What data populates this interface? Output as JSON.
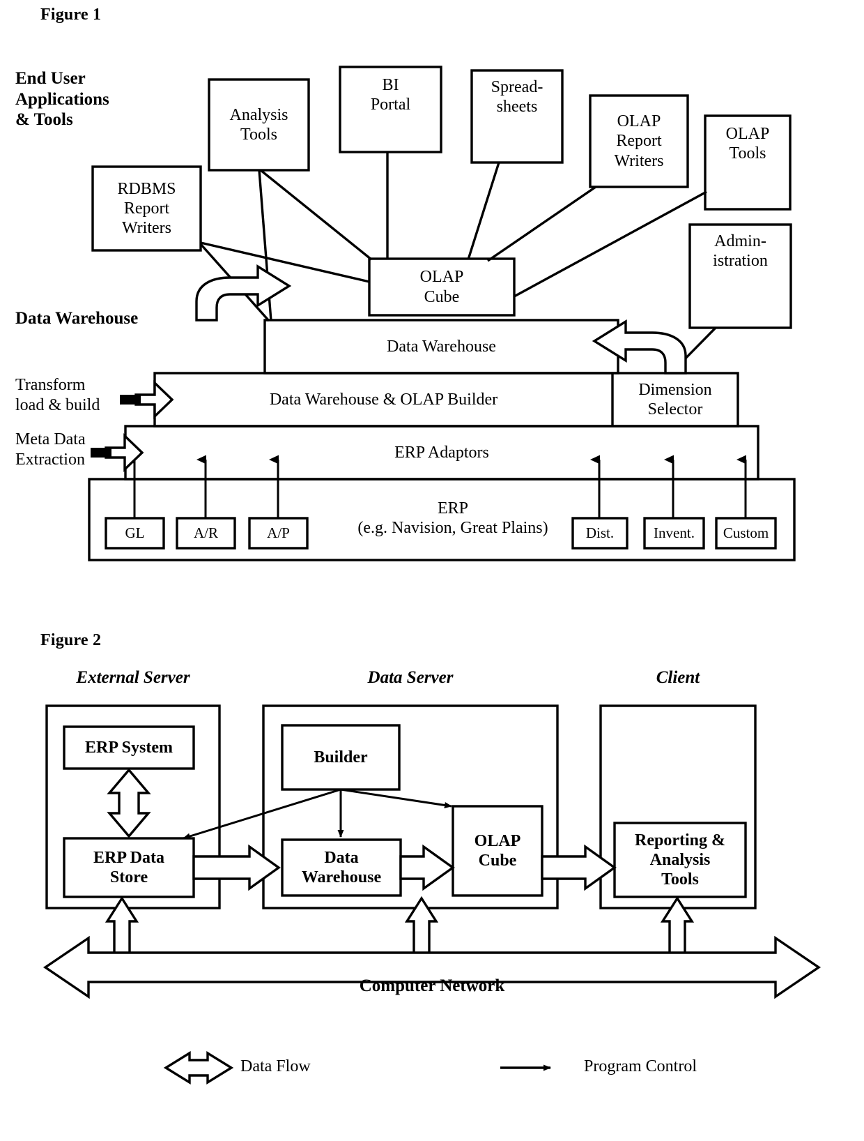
{
  "figure1": {
    "label": "Figure 1",
    "band_labels": {
      "end_user": "End User\nApplications\n& Tools",
      "end_user_l1": "End User",
      "end_user_l2": "Applications",
      "end_user_l3": "& Tools",
      "data_warehouse": "Data Warehouse"
    },
    "side_labels": {
      "transform_l1": "Transform",
      "transform_l2": "load & build",
      "meta_l1": "Meta Data",
      "meta_l2": "Extraction"
    },
    "tool_boxes": [
      {
        "name": "rdbms-report-writers",
        "lines": [
          "RDBMS",
          "Report",
          "Writers"
        ]
      },
      {
        "name": "analysis-tools",
        "lines": [
          "Analysis",
          "Tools"
        ]
      },
      {
        "name": "bi-portal",
        "lines": [
          "BI",
          "Portal"
        ]
      },
      {
        "name": "spreadsheets",
        "lines": [
          "Spread-",
          "sheets"
        ]
      },
      {
        "name": "olap-report-writers",
        "lines": [
          "OLAP",
          "Report",
          "Writers"
        ]
      },
      {
        "name": "olap-tools",
        "lines": [
          "OLAP",
          "Tools"
        ]
      },
      {
        "name": "administration",
        "lines": [
          "Admin-",
          "istration"
        ]
      }
    ],
    "olap_cube": {
      "lines": [
        "OLAP",
        "Cube"
      ]
    },
    "layers": [
      {
        "name": "data-warehouse-bar",
        "label": "Data Warehouse"
      },
      {
        "name": "builder-bar",
        "label": "Data Warehouse & OLAP Builder"
      },
      {
        "name": "dimension-selector",
        "lines": [
          "Dimension",
          "Selector"
        ]
      },
      {
        "name": "erp-adaptors-bar",
        "label": "ERP Adaptors"
      },
      {
        "name": "erp-bar",
        "lines": [
          "ERP",
          "(e.g. Navision, Great Plains)"
        ]
      }
    ],
    "erp_modules_left": [
      "GL",
      "A/R",
      "A/P"
    ],
    "erp_modules_right": [
      "Dist.",
      "Invent.",
      "Custom"
    ]
  },
  "figure2": {
    "label": "Figure 2",
    "sections": [
      {
        "name": "external-server",
        "label": "External Server"
      },
      {
        "name": "data-server",
        "label": "Data Server"
      },
      {
        "name": "client",
        "label": "Client"
      }
    ],
    "boxes": [
      {
        "name": "erp-system",
        "lines": [
          "ERP System"
        ]
      },
      {
        "name": "erp-data-store",
        "lines": [
          "ERP Data",
          "Store"
        ]
      },
      {
        "name": "builder",
        "lines": [
          "Builder"
        ]
      },
      {
        "name": "data-warehouse",
        "lines": [
          "Data",
          "Warehouse"
        ]
      },
      {
        "name": "olap-cube",
        "lines": [
          "OLAP",
          "Cube"
        ]
      },
      {
        "name": "reporting-analysis-tools",
        "lines": [
          "Reporting &",
          "Analysis",
          "Tools"
        ]
      }
    ],
    "network_label": "Computer Network",
    "legend": [
      {
        "name": "data-flow",
        "label": "Data Flow"
      },
      {
        "name": "program-control",
        "label": "Program Control"
      }
    ]
  },
  "colors": {
    "ink": "#000000",
    "paper": "#ffffff"
  }
}
